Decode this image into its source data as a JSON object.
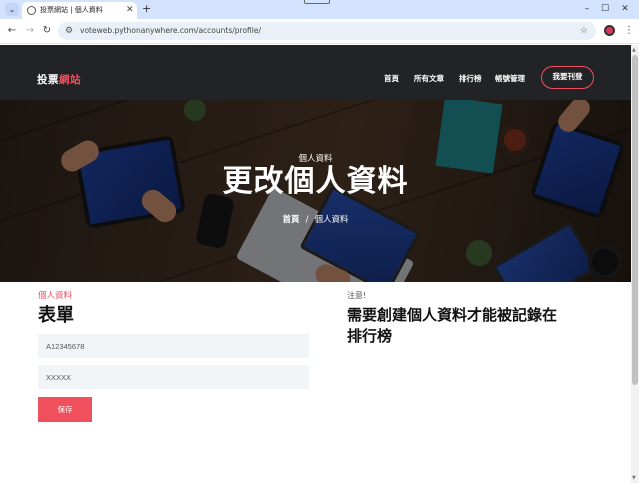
{
  "browser": {
    "tab_title": "投票網站 | 個人資料",
    "url": "voteweb.pythonanywhere.com/accounts/profile/"
  },
  "site": {
    "logo_main": "投票",
    "logo_accent": "網站",
    "nav": [
      "首頁",
      "所有文章",
      "排行榜",
      "帳號管理"
    ],
    "cta": "我要刊登"
  },
  "hero": {
    "kicker": "個人資料",
    "title": "更改個人資料",
    "breadcrumb_home": "首頁",
    "breadcrumb_sep": "/",
    "breadcrumb_current": "個人資料"
  },
  "form": {
    "kicker": "個人資料",
    "title": "表單",
    "field1_placeholder": "A12345678",
    "field2_placeholder": "XXXXX",
    "save_label": "保存"
  },
  "note": {
    "label": "注意!",
    "text": "需要創建個人資料才能被記錄在排行榜"
  },
  "colors": {
    "accent": "#f0505d",
    "header_bg": "#222327",
    "tabbar_bg": "#d3e3fd"
  }
}
